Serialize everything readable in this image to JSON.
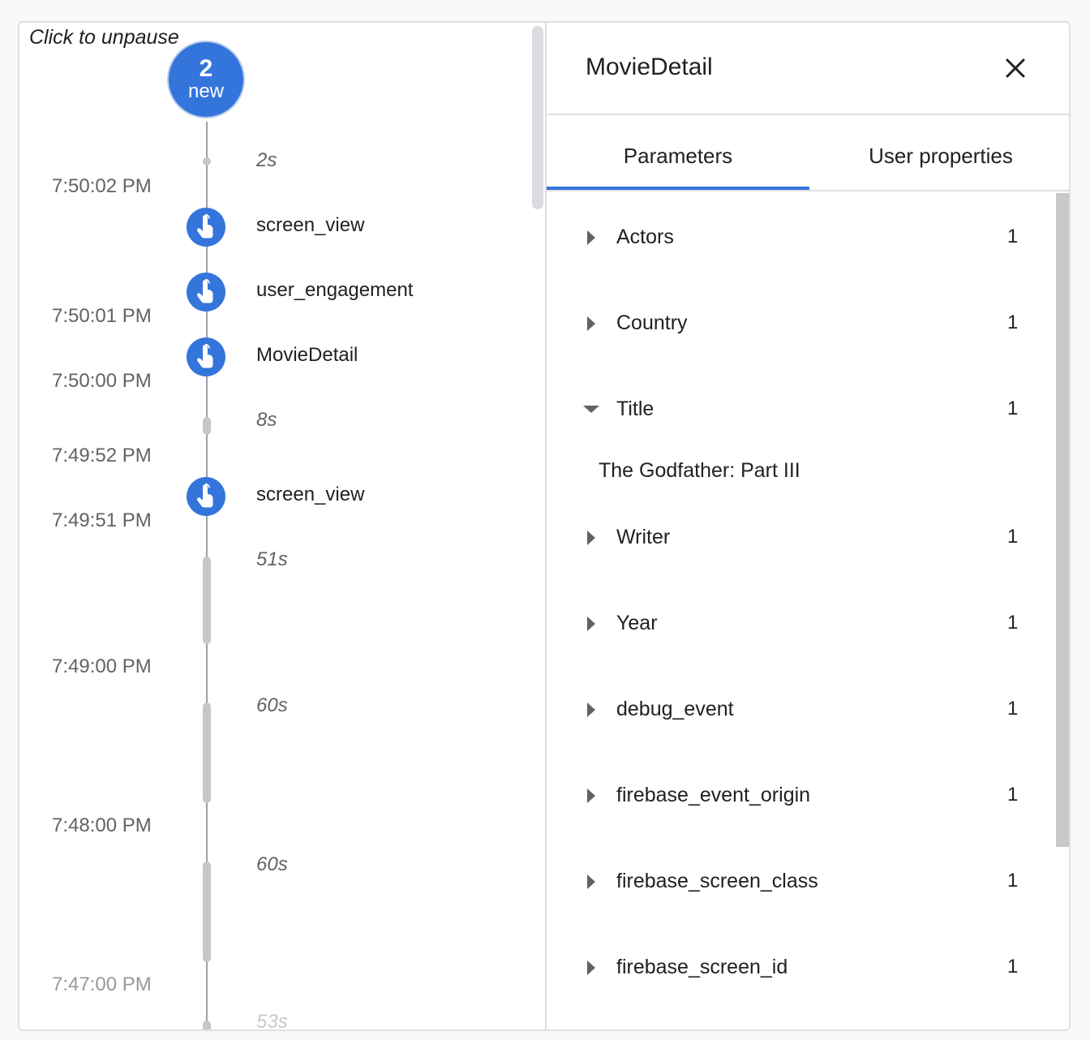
{
  "timeline": {
    "unpause_label": "Click to unpause",
    "new_count": "2",
    "new_label": "new",
    "times": [
      "7:50:02 PM",
      "7:50:01 PM",
      "7:50:00 PM",
      "7:49:52 PM",
      "7:49:51 PM",
      "7:49:00 PM",
      "7:48:00 PM",
      "7:47:00 PM"
    ],
    "gaps": [
      "2s",
      "8s",
      "51s",
      "60s",
      "60s",
      "53s"
    ],
    "events": [
      "screen_view",
      "user_engagement",
      "MovieDetail",
      "screen_view"
    ]
  },
  "panel": {
    "title": "MovieDetail",
    "tabs": [
      "Parameters",
      "User properties"
    ],
    "active_tab": "Parameters",
    "params": [
      {
        "name": "Actors",
        "count": "1",
        "expanded": false
      },
      {
        "name": "Country",
        "count": "1",
        "expanded": false
      },
      {
        "name": "Title",
        "count": "1",
        "expanded": true,
        "value": "The Godfather: Part III"
      },
      {
        "name": "Writer",
        "count": "1",
        "expanded": false
      },
      {
        "name": "Year",
        "count": "1",
        "expanded": false
      },
      {
        "name": "debug_event",
        "count": "1",
        "expanded": false
      },
      {
        "name": "firebase_event_origin",
        "count": "1",
        "expanded": false
      },
      {
        "name": "firebase_screen_class",
        "count": "1",
        "expanded": false
      },
      {
        "name": "firebase_screen_id",
        "count": "1",
        "expanded": false
      }
    ]
  },
  "colors": {
    "accent": "#3475dc",
    "text": "#202124",
    "muted": "#5f6368",
    "timeline_track": "#c4c7cb"
  },
  "icons": {
    "event": "touch-hand-icon",
    "close": "close-icon",
    "collapsed": "triangle-right-icon",
    "expanded": "triangle-down-icon"
  }
}
